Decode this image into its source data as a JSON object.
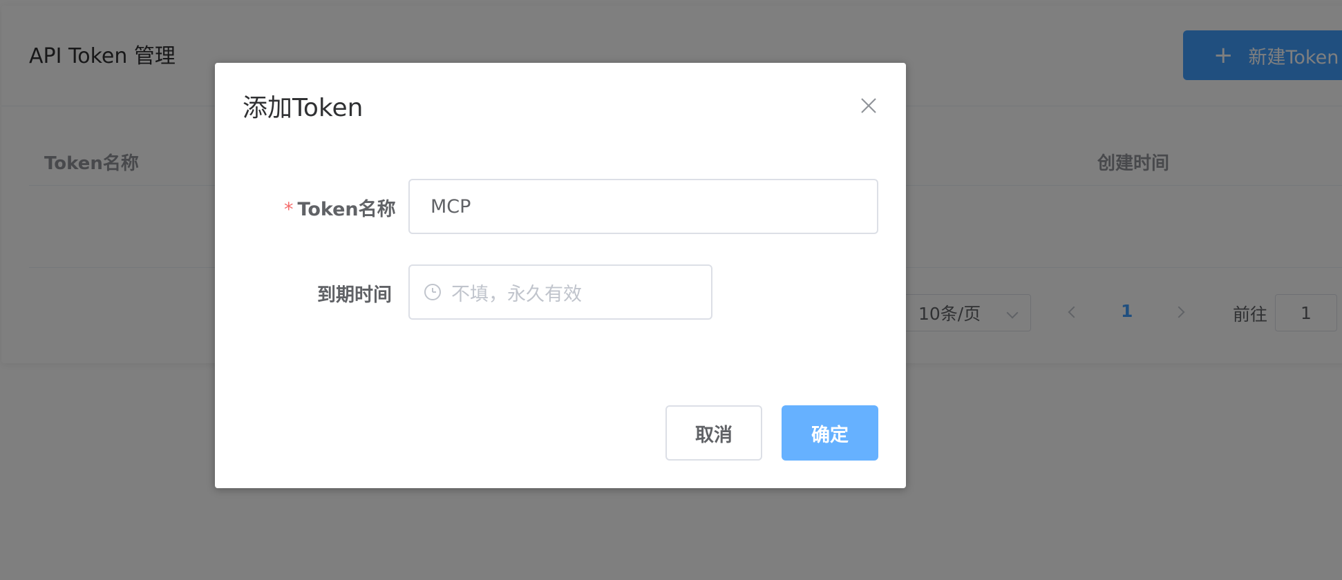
{
  "page": {
    "title": "API Token 管理",
    "new_token_label": "新建Token",
    "table": {
      "columns": [
        "Token名称",
        "创建时间"
      ]
    },
    "pagination": {
      "page_size": "10条/页",
      "current_page": "1",
      "goto_label": "前往",
      "goto_value": "1"
    }
  },
  "dialog": {
    "title": "添加Token",
    "form": {
      "name_label": "Token名称",
      "name_required_mark": "*",
      "name_value": "MCP",
      "expiry_label": "到期时间",
      "expiry_placeholder": "不填，永久有效"
    },
    "cancel_label": "取消",
    "confirm_label": "确定"
  },
  "colors": {
    "primary": "#409eff",
    "primary_light": "#66b1ff",
    "required": "#f56c6c",
    "overlay": "rgba(0,0,0,0.5)"
  },
  "icons": {
    "close": "close-icon",
    "clock": "clock-icon",
    "plus": "plus-icon",
    "chevron_down": "chevron-down-icon",
    "chevron_left": "chevron-left-icon",
    "chevron_right": "chevron-right-icon"
  }
}
